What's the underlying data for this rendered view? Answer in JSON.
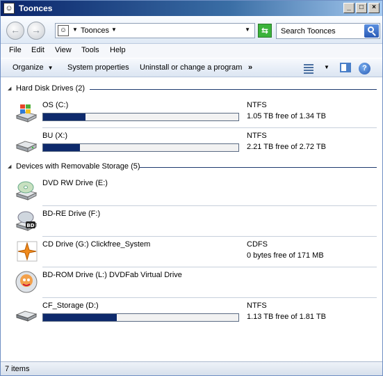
{
  "window": {
    "title": "Tooncés",
    "title_plain": "Toonces"
  },
  "address": {
    "crumb": "Toonces",
    "search_placeholder": "Search Toonces"
  },
  "menu": {
    "items": [
      "File",
      "Edit",
      "View",
      "Tools",
      "Help"
    ]
  },
  "commands": {
    "organize": "Organize",
    "system_properties": "System properties",
    "uninstall": "Uninstall or change a program",
    "more": "»"
  },
  "groups": [
    {
      "label": "Hard Disk Drives (2)",
      "drives": [
        {
          "name": "OS (C:)",
          "fs": "NTFS",
          "free_text": "1.05 TB free of 1.34 TB",
          "used_fraction": 0.216,
          "icon": "windows-drive-icon"
        },
        {
          "name": "BU (X:)",
          "fs": "NTFS",
          "free_text": "2.21 TB free of 2.72 TB",
          "used_fraction": 0.188,
          "icon": "hard-drive-icon"
        }
      ]
    },
    {
      "label": "Devices with Removable Storage (5)",
      "drives": [
        {
          "name": "DVD RW Drive (E:)",
          "fs": "",
          "free_text": "",
          "used_fraction": null,
          "icon": "dvd-drive-icon"
        },
        {
          "name": "BD-RE Drive (F:)",
          "fs": "",
          "free_text": "",
          "used_fraction": null,
          "icon": "bd-drive-icon"
        },
        {
          "name": "CD Drive (G:) Clickfree_System",
          "fs": "CDFS",
          "free_text": "0 bytes free of 171 MB",
          "used_fraction": null,
          "icon": "clickfree-icon"
        },
        {
          "name": "BD-ROM Drive (L:) DVDFab Virtual Drive",
          "fs": "",
          "free_text": "",
          "used_fraction": null,
          "icon": "dvdfab-icon"
        },
        {
          "name": "CF_Storage (D:)",
          "fs": "NTFS",
          "free_text": "1.13 TB free of 1.81 TB",
          "used_fraction": 0.376,
          "icon": "removable-drive-icon"
        }
      ]
    }
  ],
  "status": {
    "items_text": "7 items"
  },
  "colors": {
    "bar_fill": "#0e2a6c",
    "group_line": "#1e3a6e",
    "title_bar": "#0a246a"
  }
}
